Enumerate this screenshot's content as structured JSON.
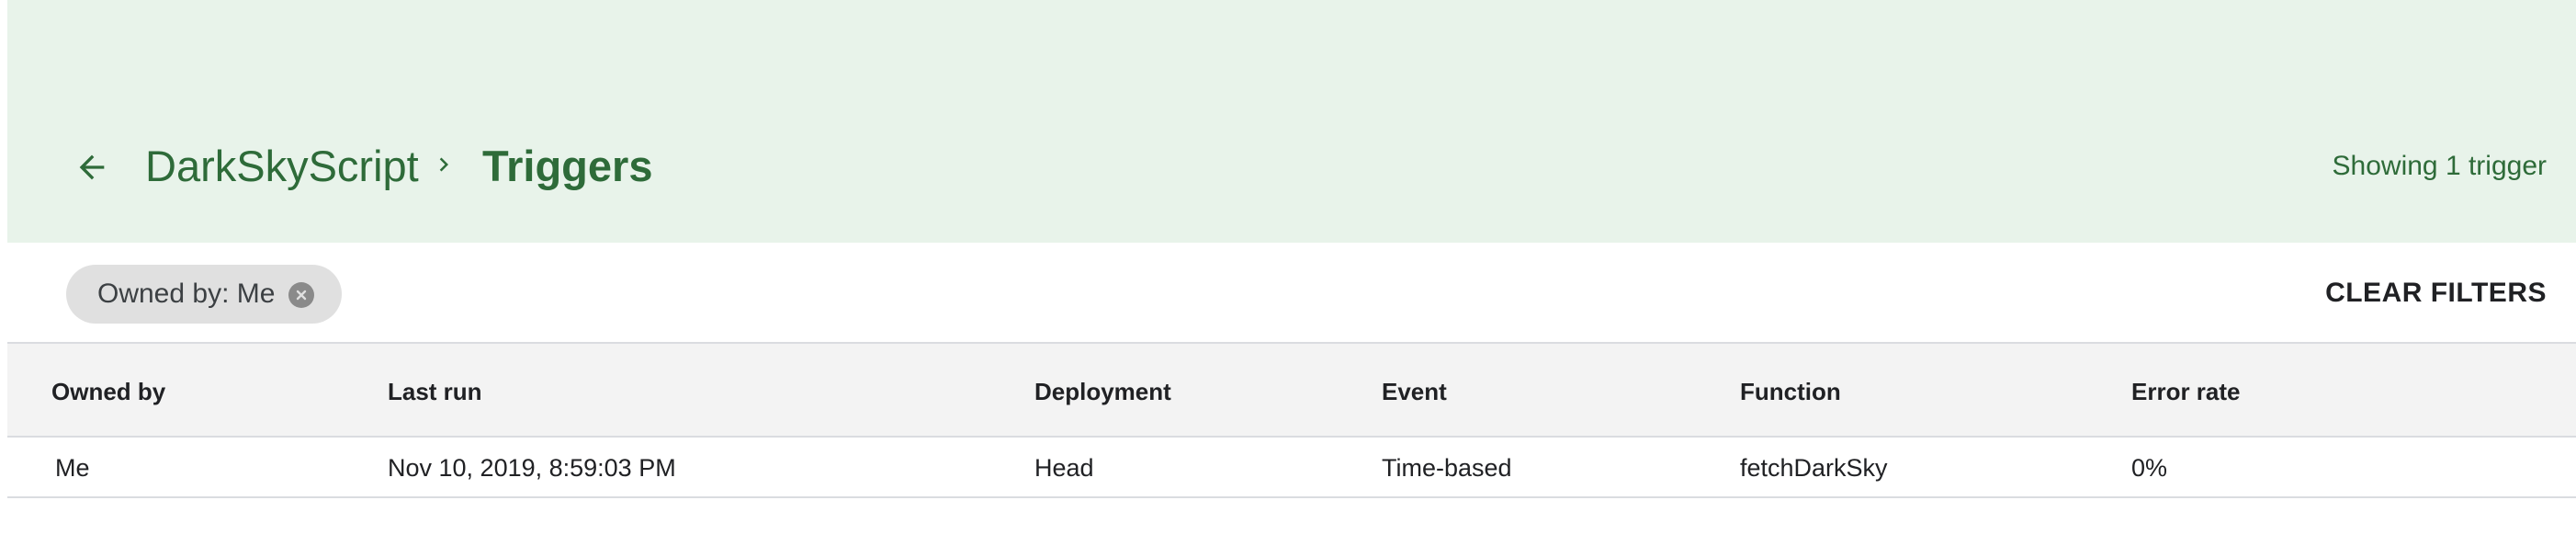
{
  "header": {
    "back_icon": "arrow-back-icon",
    "project_name": "DarkSkyScript",
    "separator_icon": "chevron-right-icon",
    "page_title": "Triggers",
    "trigger_count": "Showing 1 trigger"
  },
  "filters": {
    "chip_label": "Owned by: Me",
    "chip_close_icon": "close-circle-icon",
    "clear_label": "CLEAR FILTERS"
  },
  "table": {
    "columns": [
      "Owned by",
      "Last run",
      "Deployment",
      "Event",
      "Function",
      "Error rate"
    ],
    "rows": [
      [
        "Me",
        "Nov 10, 2019, 8:59:03 PM",
        "Head",
        "Time-based",
        "fetchDarkSky",
        "0%"
      ]
    ]
  },
  "colors": {
    "header_bg": "#e8f3ea",
    "accent_green": "#2e6b39",
    "chip_bg": "#e0e0e0",
    "table_header_bg": "#f3f3f3"
  }
}
